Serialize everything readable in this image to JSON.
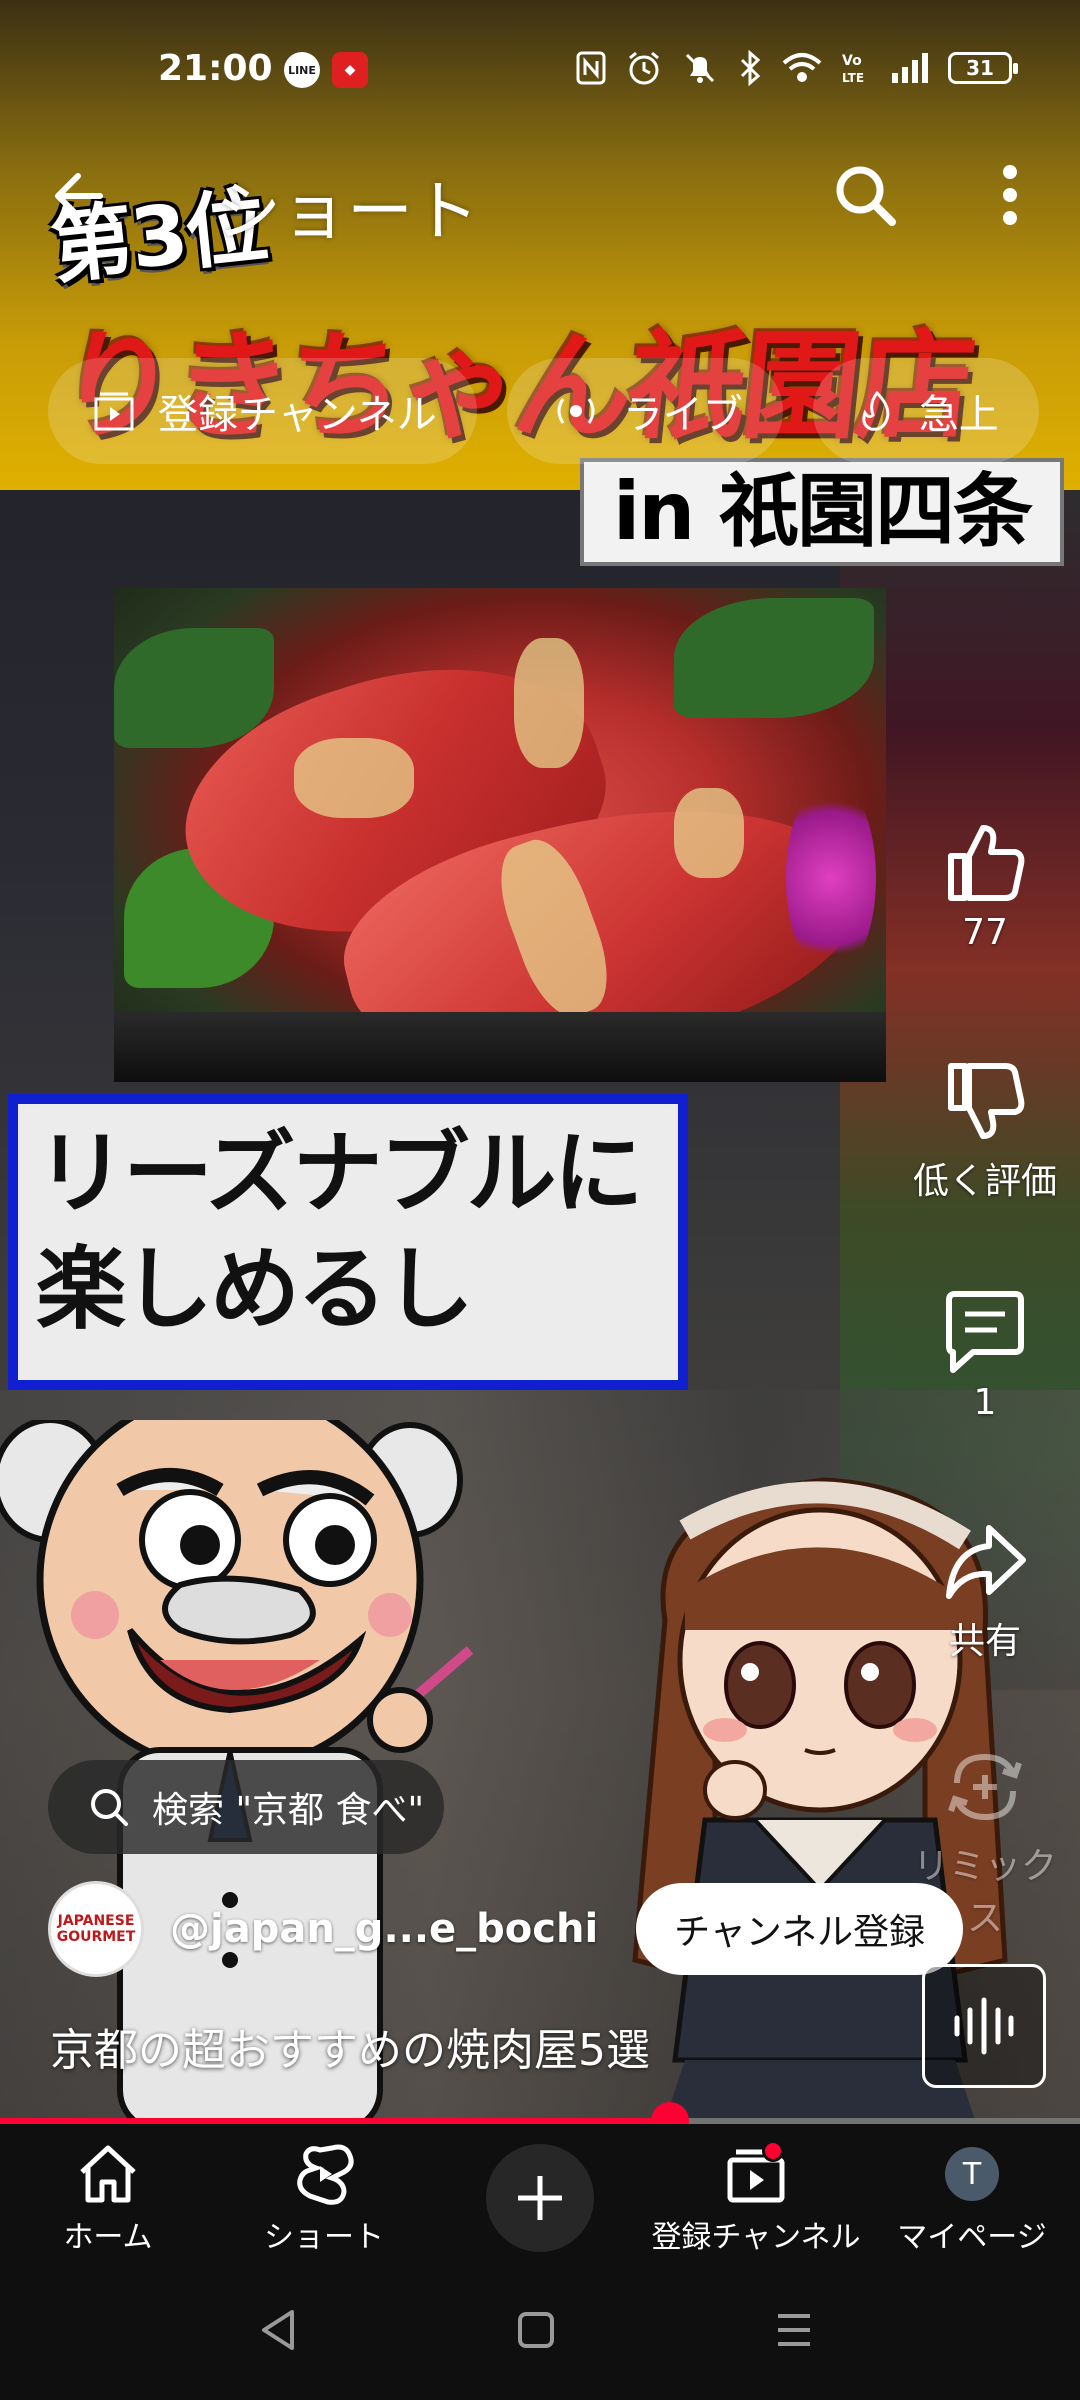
{
  "status_bar": {
    "time": "21:00",
    "notif_icons": [
      "line-icon",
      "app-icon"
    ],
    "battery": "31",
    "system_icons": [
      "nfc-icon",
      "alarm-icon",
      "mute-icon",
      "bluetooth-icon",
      "wifi-icon",
      "volte-icon",
      "signal-icon",
      "battery-icon"
    ]
  },
  "top_bar": {
    "title": "ショート"
  },
  "chips": [
    {
      "label": "登録チャンネル",
      "icon": "subscriptions-icon"
    },
    {
      "label": "ライブ",
      "icon": "live-icon"
    },
    {
      "label": "急上",
      "icon": "trending-icon"
    }
  ],
  "video_overlay": {
    "rank_text": "第3位",
    "shop_name": "りきちゃん祇園店",
    "location": "in 祇園四条",
    "caption_line1": "リーズナブルに",
    "caption_line2": "楽しめるし"
  },
  "actions": {
    "like_count": "77",
    "dislike_label": "低く評価",
    "comment_count": "1",
    "share_label": "共有",
    "remix_label": "リミックス"
  },
  "search_pill": {
    "text": "検索 \"京都 食べ\""
  },
  "channel": {
    "avatar_text": "JAPANESE GOURMET",
    "handle": "@japan_g...e_bochi",
    "subscribe_label": "チャンネル登録"
  },
  "video_title": "京都の超おすすめの焼肉屋5選",
  "progress": {
    "fraction": 0.62
  },
  "bottom_nav": [
    {
      "label": "ホーム",
      "icon": "home-icon"
    },
    {
      "label": "ショート",
      "icon": "shorts-icon"
    },
    {
      "label": "",
      "icon": "plus-icon"
    },
    {
      "label": "登録チャンネル",
      "icon": "subscriptions-icon"
    },
    {
      "label": "マイページ",
      "icon": "avatar-icon",
      "avatar_letter": "T"
    }
  ],
  "colors": {
    "accent": "#ff0033",
    "caption_border": "#1020d0",
    "shop_name": "#e11818"
  }
}
